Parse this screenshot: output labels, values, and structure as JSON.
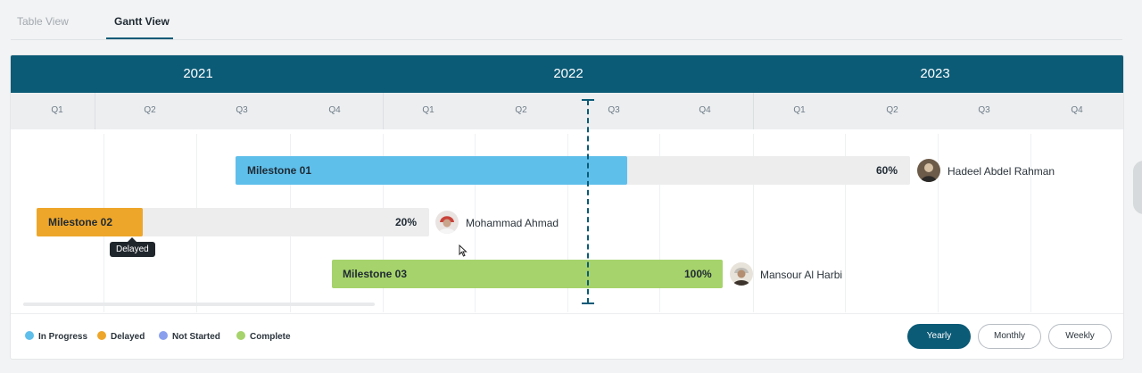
{
  "tabs": [
    {
      "label": "Table View",
      "active": false
    },
    {
      "label": "Gantt View",
      "active": true
    }
  ],
  "timeline": {
    "years": [
      "2021",
      "2022",
      "2023"
    ],
    "quarters": [
      "Q1",
      "Q2",
      "Q3",
      "Q4",
      "Q1",
      "Q2",
      "Q3",
      "Q4",
      "Q1",
      "Q2",
      "Q3",
      "Q4"
    ]
  },
  "milestones": [
    {
      "name": "Milestone 01",
      "progress": "60%",
      "owner": "Hadeel Abdel Rahman",
      "status": "In Progress"
    },
    {
      "name": "Milestone 02",
      "progress": "20%",
      "owner": "Mohammad Ahmad",
      "status": "Delayed",
      "tooltip": "Delayed"
    },
    {
      "name": "Milestone 03",
      "progress": "100%",
      "owner": "Mansour Al Harbi",
      "status": "Complete"
    }
  ],
  "legend": [
    {
      "label": "In Progress",
      "color": "#5fbfeb"
    },
    {
      "label": "Delayed",
      "color": "#eea62a"
    },
    {
      "label": "Not Started",
      "color": "#8aa0ee"
    },
    {
      "label": "Complete",
      "color": "#a6d36b"
    }
  ],
  "views": {
    "yearly": "Yearly",
    "monthly": "Monthly",
    "weekly": "Weekly",
    "selected": "Yearly"
  },
  "colors": {
    "header": "#0b5a76",
    "in_progress": "#5fbfeb",
    "delayed": "#eea62a",
    "complete": "#a6d36b",
    "track": "#ededee"
  }
}
